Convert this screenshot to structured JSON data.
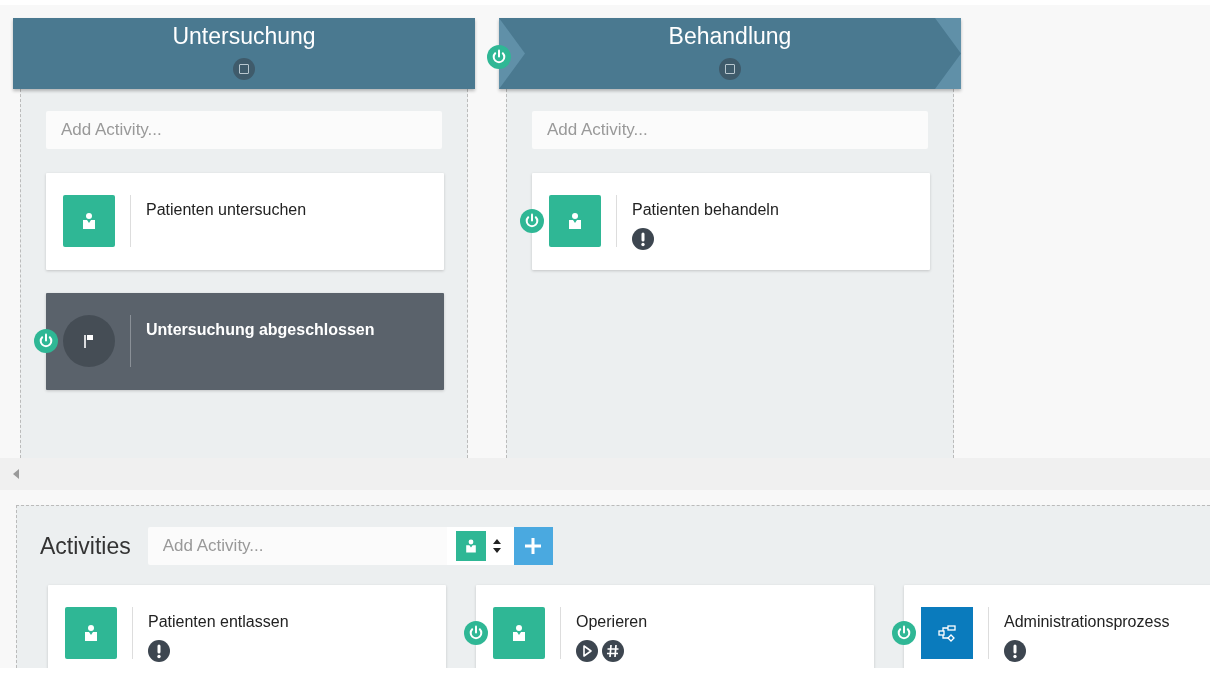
{
  "stages": [
    {
      "title": "Untersuchung",
      "entry_criterion": false,
      "placeholder": "Add Activity...",
      "activities": [
        {
          "kind": "human_task",
          "title": "Patienten untersuchen",
          "entry_criterion": false,
          "required": false,
          "manual_activation": false,
          "repetition": false
        },
        {
          "kind": "milestone",
          "title": "Untersuchung abgeschlossen",
          "entry_criterion": true,
          "required": false,
          "manual_activation": false,
          "repetition": false
        }
      ]
    },
    {
      "title": "Behandlung",
      "entry_criterion": true,
      "placeholder": "Add Activity...",
      "activities": [
        {
          "kind": "human_task",
          "title": "Patienten behandeln",
          "entry_criterion": true,
          "required": true,
          "manual_activation": false,
          "repetition": false
        }
      ]
    }
  ],
  "activities_panel": {
    "title": "Activities",
    "placeholder": "Add Activity...",
    "activities": [
      {
        "kind": "human_task",
        "title": "Patienten entlassen",
        "entry_criterion": false,
        "required": true,
        "manual_activation": false,
        "repetition": false
      },
      {
        "kind": "human_task",
        "title": "Operieren",
        "entry_criterion": true,
        "required": false,
        "manual_activation": true,
        "repetition": true
      },
      {
        "kind": "process_task",
        "title": "Administrationsprozess",
        "entry_criterion": true,
        "required": true,
        "manual_activation": false,
        "repetition": false
      }
    ]
  }
}
